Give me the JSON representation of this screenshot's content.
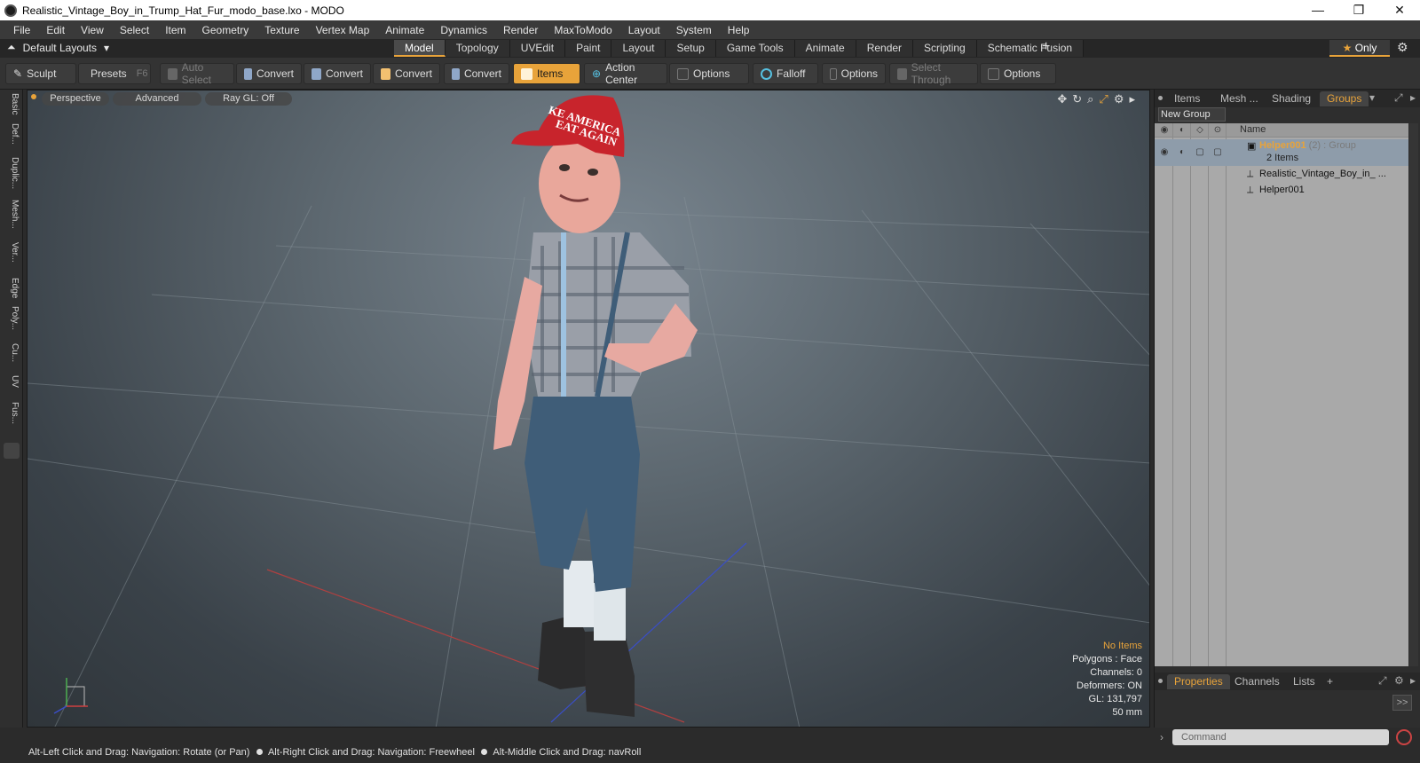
{
  "window": {
    "title": "Realistic_Vintage_Boy_in_Trump_Hat_Fur_modo_base.lxo - MODO",
    "controls": [
      "—",
      "❐",
      "✕"
    ]
  },
  "menu": [
    "File",
    "Edit",
    "View",
    "Select",
    "Item",
    "Geometry",
    "Texture",
    "Vertex Map",
    "Animate",
    "Dynamics",
    "Render",
    "MaxToModo",
    "Layout",
    "System",
    "Help"
  ],
  "layout_bar": {
    "layout_label": "Default Layouts",
    "tabs": [
      "Model",
      "Topology",
      "UVEdit",
      "Paint",
      "Layout",
      "Setup",
      "Game Tools",
      "Animate",
      "Render",
      "Scripting",
      "Schematic Fusion"
    ],
    "active_tab": "Model",
    "plus": "+",
    "only_label": "Only",
    "star": "★"
  },
  "toolbar": {
    "sculpt": "Sculpt",
    "presets": "Presets",
    "presets_key": "F6",
    "auto_select": "Auto Select",
    "convert": "Convert",
    "items": "Items",
    "action_center": "Action Center",
    "options": "Options",
    "falloff": "Falloff",
    "select_through": "Select Through"
  },
  "left_strip": [
    "Basic",
    "Def...",
    "Duplic...",
    "Mesh...",
    "Ver...",
    "Edge",
    "Poly...",
    "Cu...",
    "UV",
    "Fus..."
  ],
  "viewport": {
    "view_mode": "Perspective",
    "shading": "Advanced",
    "raygl": "Ray GL: Off",
    "hat_text_1": "KE AMERICA",
    "hat_text_2": "EAT AGAIN",
    "info": {
      "no_items": "No Items",
      "polygons": "Polygons : Face",
      "channels": "Channels: 0",
      "deformers": "Deformers: ON",
      "gl": "GL: 131,797",
      "focal": "50 mm"
    }
  },
  "right_panel": {
    "top_tabs": [
      "Items",
      "Mesh ...",
      "Shading",
      "Groups"
    ],
    "active_top_tab": "Groups",
    "new_group": "New Group",
    "column_name": "Name",
    "group": {
      "name": "Helper001",
      "count": "(2)",
      "type": ": Group",
      "items_label": "2 Items"
    },
    "children": [
      "Realistic_Vintage_Boy_in_ ...",
      "Helper001"
    ],
    "bottom_tabs": [
      "Properties",
      "Channels",
      "Lists"
    ],
    "active_bottom_tab": "Properties",
    "plus": "+",
    "expand": ">>",
    "command_placeholder": "Command"
  },
  "status_bar": {
    "hint1": "Alt-Left Click and Drag: Navigation: Rotate (or Pan)",
    "hint2": "Alt-Right Click and Drag: Navigation: Freewheel",
    "hint3": "Alt-Middle Click and Drag: navRoll"
  }
}
